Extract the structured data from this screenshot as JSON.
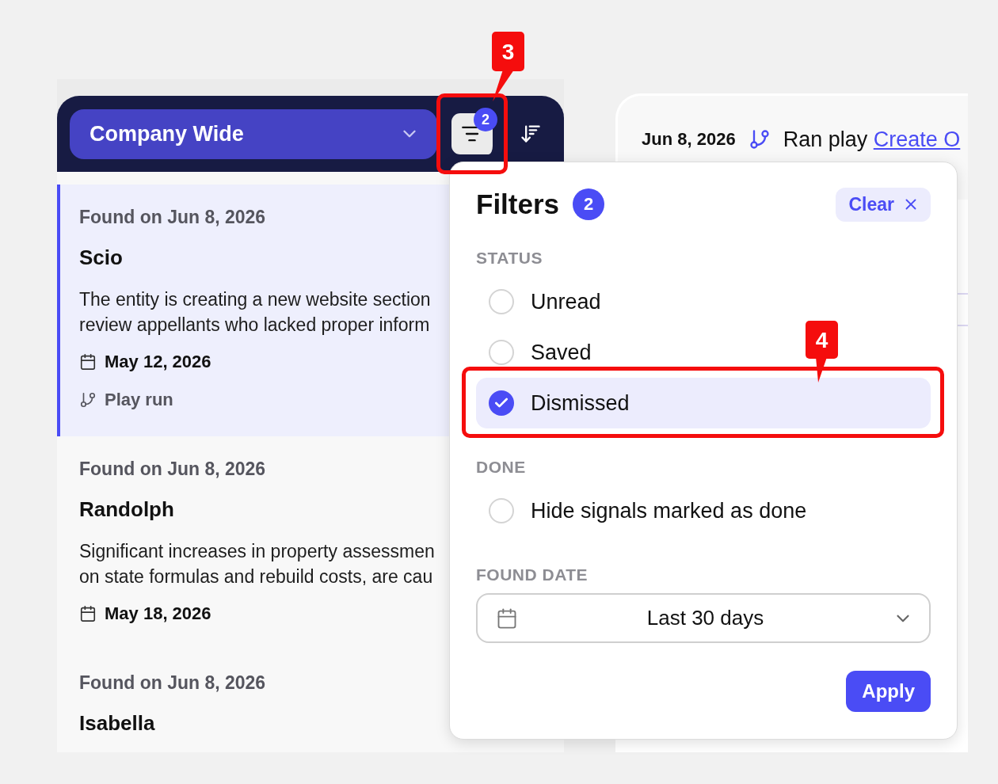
{
  "header": {
    "scope": "Company Wide",
    "filter_count": "2"
  },
  "signals": [
    {
      "found": "Found on Jun 8, 2026",
      "title": "Scio",
      "description": "The entity is creating a new website section review appellants who lacked proper inform",
      "date": "May 12, 2026",
      "play_run": "Play run",
      "selected": true
    },
    {
      "found": "Found on Jun 8, 2026",
      "title": "Randolph",
      "description": "Significant increases in property assessmen on state formulas and rebuild costs, are cau",
      "date": "May 18, 2026",
      "selected": false
    },
    {
      "found": "Found on Jun 8, 2026",
      "title": "Isabella",
      "selected": false
    }
  ],
  "detail": {
    "date": "Jun 8, 2026",
    "activity": "Ran play",
    "link": "Create O"
  },
  "filters": {
    "title": "Filters",
    "count": "2",
    "clear": "Clear",
    "sections": [
      {
        "heading": "STATUS",
        "kind": "options",
        "options": [
          {
            "label": "Unread",
            "checked": false
          },
          {
            "label": "Saved",
            "checked": false
          },
          {
            "label": "Dismissed",
            "checked": true
          }
        ]
      },
      {
        "heading": "DONE",
        "kind": "options",
        "options": [
          {
            "label": "Hide signals marked as done",
            "checked": false
          }
        ]
      },
      {
        "heading": "FOUND DATE",
        "kind": "select",
        "value": "Last 30 days"
      }
    ],
    "apply": "Apply"
  },
  "annotations": [
    {
      "label": "3"
    },
    {
      "label": "4"
    }
  ]
}
